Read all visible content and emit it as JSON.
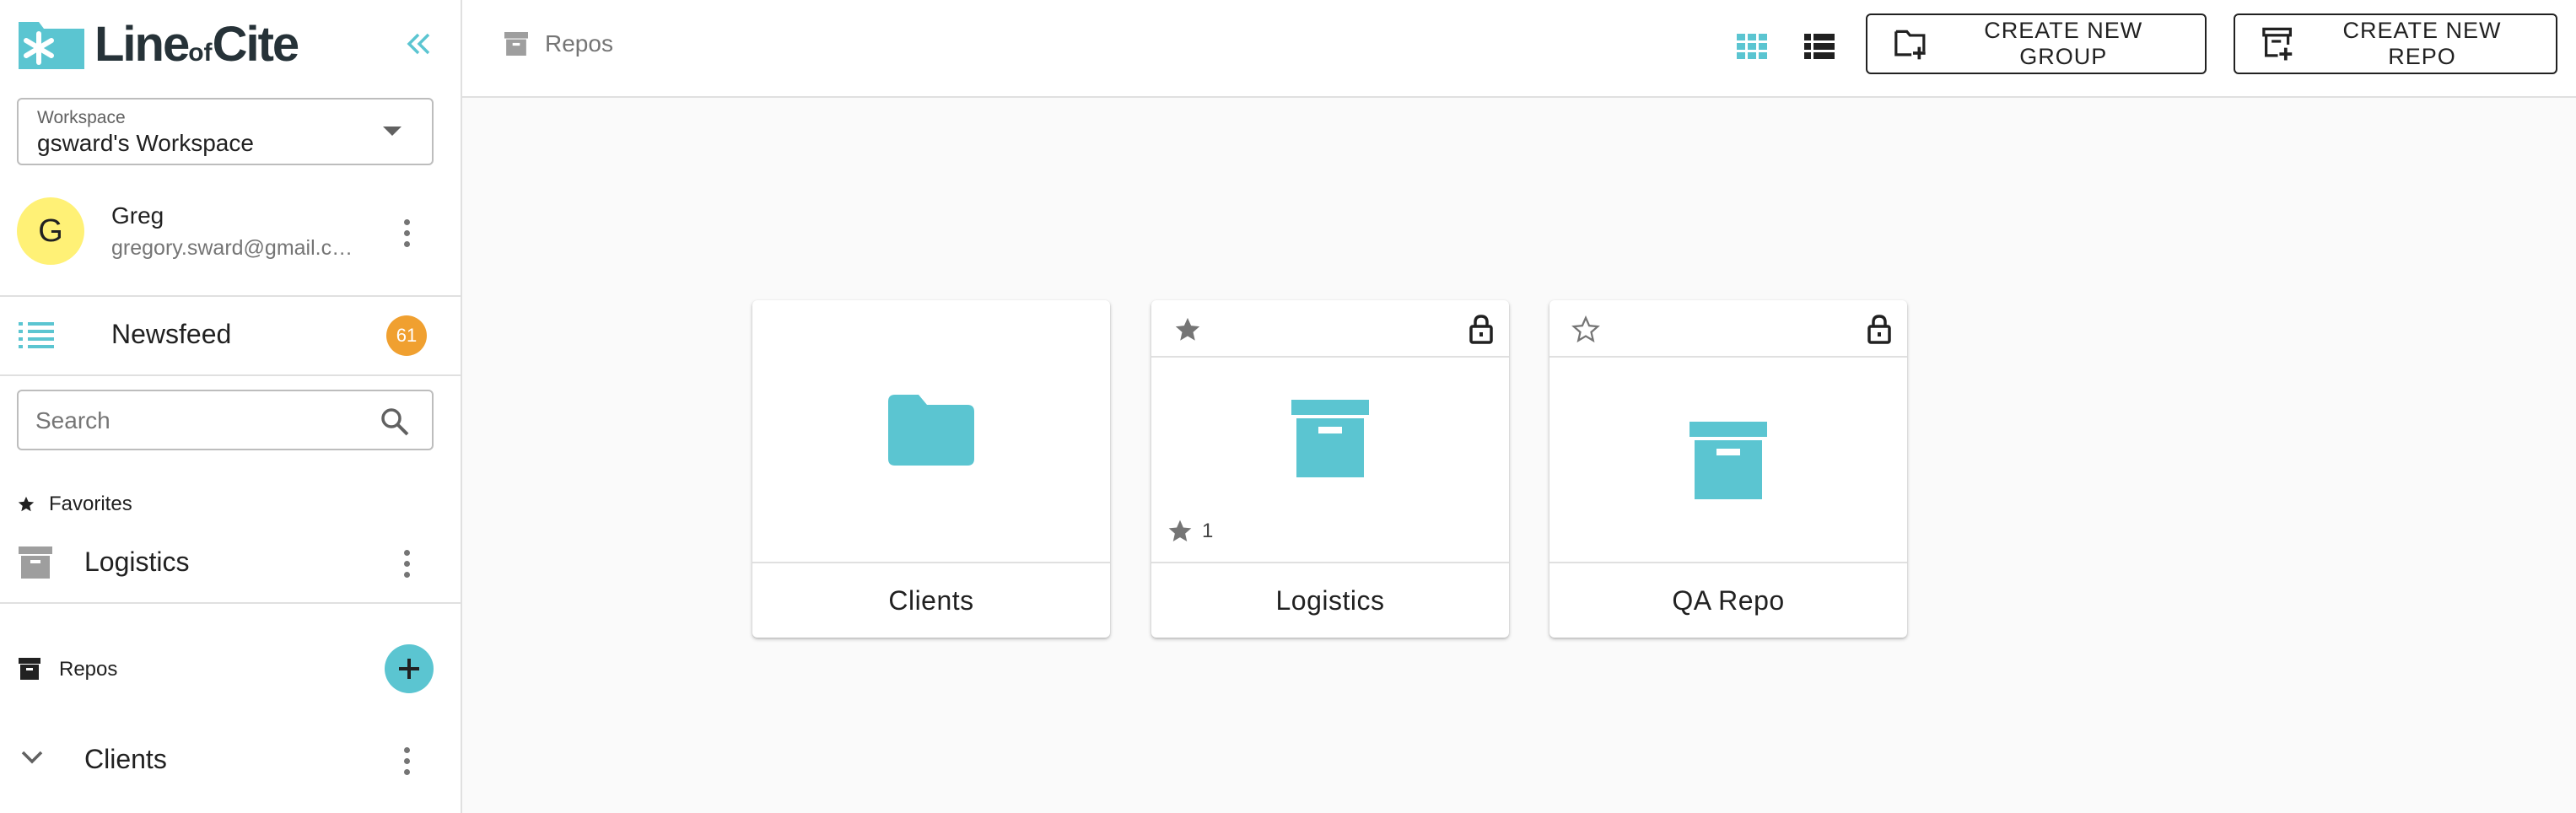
{
  "app": {
    "logo_text_line": "Line",
    "logo_text_of": "of",
    "logo_text_cite": "Cite"
  },
  "sidebar": {
    "workspace": {
      "label": "Workspace",
      "value": "gsward's Workspace"
    },
    "user": {
      "initial": "G",
      "name": "Greg",
      "email": "gregory.sward@gmail.com"
    },
    "newsfeed": {
      "label": "Newsfeed",
      "count": "61"
    },
    "search": {
      "placeholder": "Search"
    },
    "favorites": {
      "header": "Favorites",
      "items": [
        {
          "label": "Logistics"
        }
      ]
    },
    "repos": {
      "header": "Repos",
      "items": [
        {
          "label": "Clients"
        }
      ]
    }
  },
  "topbar": {
    "breadcrumb": "Repos",
    "create_group_label": "CREATE NEW GROUP",
    "create_repo_label": "CREATE NEW REPO"
  },
  "cards": [
    {
      "name": "Clients",
      "kind": "group"
    },
    {
      "name": "Logistics",
      "kind": "repo",
      "starred": true,
      "locked": true,
      "star_count": "1"
    },
    {
      "name": "QA Repo",
      "kind": "repo",
      "starred": false,
      "locked": true
    }
  ],
  "colors": {
    "accent": "#5bc5d1",
    "badge": "#f0a030",
    "avatar": "#fff176",
    "text": "#212121",
    "muted": "#757575"
  }
}
